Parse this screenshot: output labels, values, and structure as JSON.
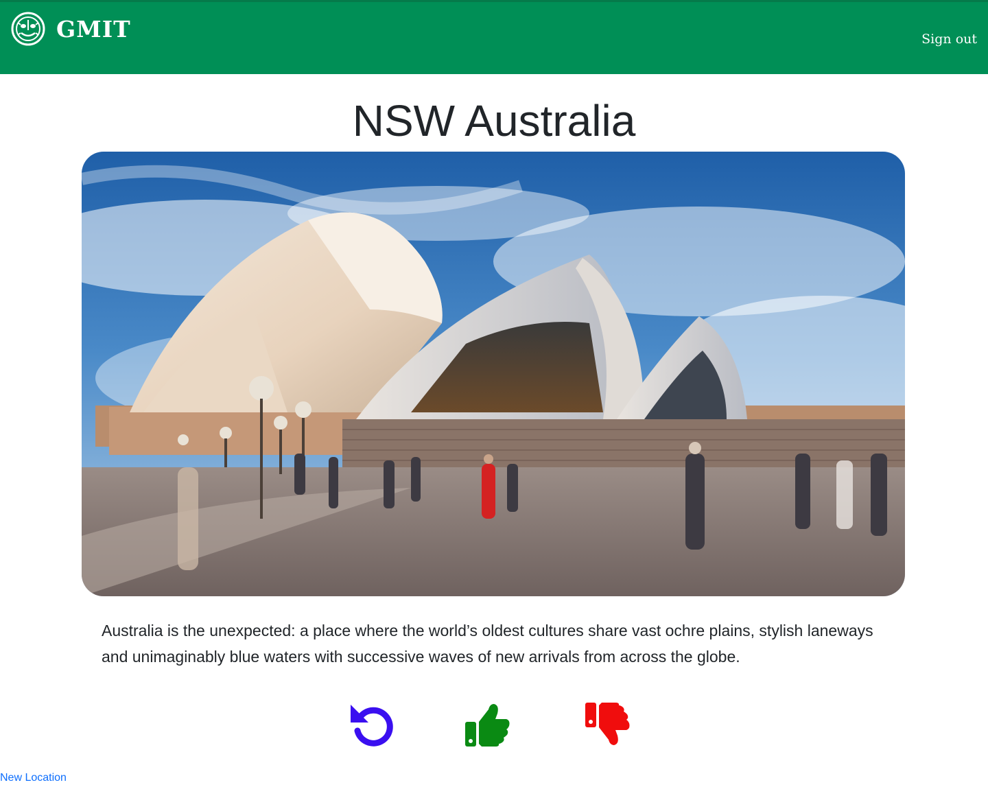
{
  "header": {
    "brand_name": "GMIT",
    "logo_icon": "gmit-crest-icon",
    "sign_out_label": "Sign out",
    "background_color": "#008f56"
  },
  "main": {
    "title": "NSW Australia",
    "image_subject": "sydney-opera-house-photo",
    "description": "Australia is the unexpected: a place where the world’s oldest cultures share vast ochre plains, stylish laneways and unimaginably blue waters with successive waves of new arrivals from across the globe."
  },
  "actions": [
    {
      "icon": "rotate-left-icon",
      "color": "#3a0ff0"
    },
    {
      "icon": "thumbs-up-icon",
      "color": "#0a8a13"
    },
    {
      "icon": "thumbs-down-icon",
      "color": "#f00d0d"
    }
  ],
  "footer": {
    "new_location_label": "New Location",
    "link_color": "#0d6efd"
  }
}
